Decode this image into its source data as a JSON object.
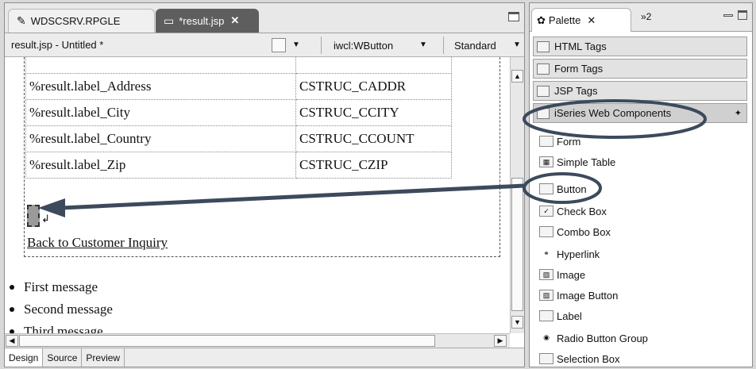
{
  "editor": {
    "tabs": [
      {
        "label": "WDSCSRV.RPGLE",
        "icon": "pencil-icon",
        "active": false
      },
      {
        "label": "*result.jsp",
        "icon": "jsp-file-icon",
        "active": true,
        "close": "✕"
      }
    ],
    "toolbar": {
      "doc_title": "result.jsp - Untitled *",
      "component_combo": "iwcl:WButton",
      "mode_combo": "Standard"
    },
    "table_rows": [
      {
        "label": "%result.label_Address",
        "field": "CSTRUC_CADDR"
      },
      {
        "label": "%result.label_City",
        "field": "CSTRUC_CCITY"
      },
      {
        "label": "%result.label_Country",
        "field": "CSTRUC_CCOUNT"
      },
      {
        "label": "%result.label_Zip",
        "field": "CSTRUC_CZIP"
      }
    ],
    "return_glyph": "↲",
    "back_link": "Back to Customer Inquiry",
    "messages": [
      "First message",
      "Second message",
      "Third message"
    ],
    "bottom_tabs": [
      "Design",
      "Source",
      "Preview"
    ]
  },
  "palette": {
    "title": "Palette",
    "close": "✕",
    "overflow": "»2",
    "drawers": [
      {
        "label": "HTML Tags",
        "icon": "html-tags-icon"
      },
      {
        "label": "Form Tags",
        "icon": "form-tags-icon"
      },
      {
        "label": "JSP Tags",
        "icon": "jsp-tags-icon"
      },
      {
        "label": "iSeries Web Components",
        "icon": "iseries-components-icon",
        "open": true
      }
    ],
    "items": [
      {
        "label": "Form",
        "icon": "form-icon"
      },
      {
        "label": "Simple Table",
        "icon": "table-icon"
      },
      {
        "label": "Button",
        "icon": "button-icon"
      },
      {
        "label": "Check Box",
        "icon": "checkbox-icon"
      },
      {
        "label": "Combo Box",
        "icon": "combobox-icon"
      },
      {
        "label": "Hyperlink",
        "icon": "hyperlink-icon"
      },
      {
        "label": "Image",
        "icon": "image-icon"
      },
      {
        "label": "Image Button",
        "icon": "image-button-icon"
      },
      {
        "label": "Label",
        "icon": "label-icon"
      },
      {
        "label": "Radio Button Group",
        "icon": "radio-icon"
      },
      {
        "label": "Selection Box",
        "icon": "selection-box-icon"
      }
    ]
  },
  "annotation_color": "#3c4a5c"
}
